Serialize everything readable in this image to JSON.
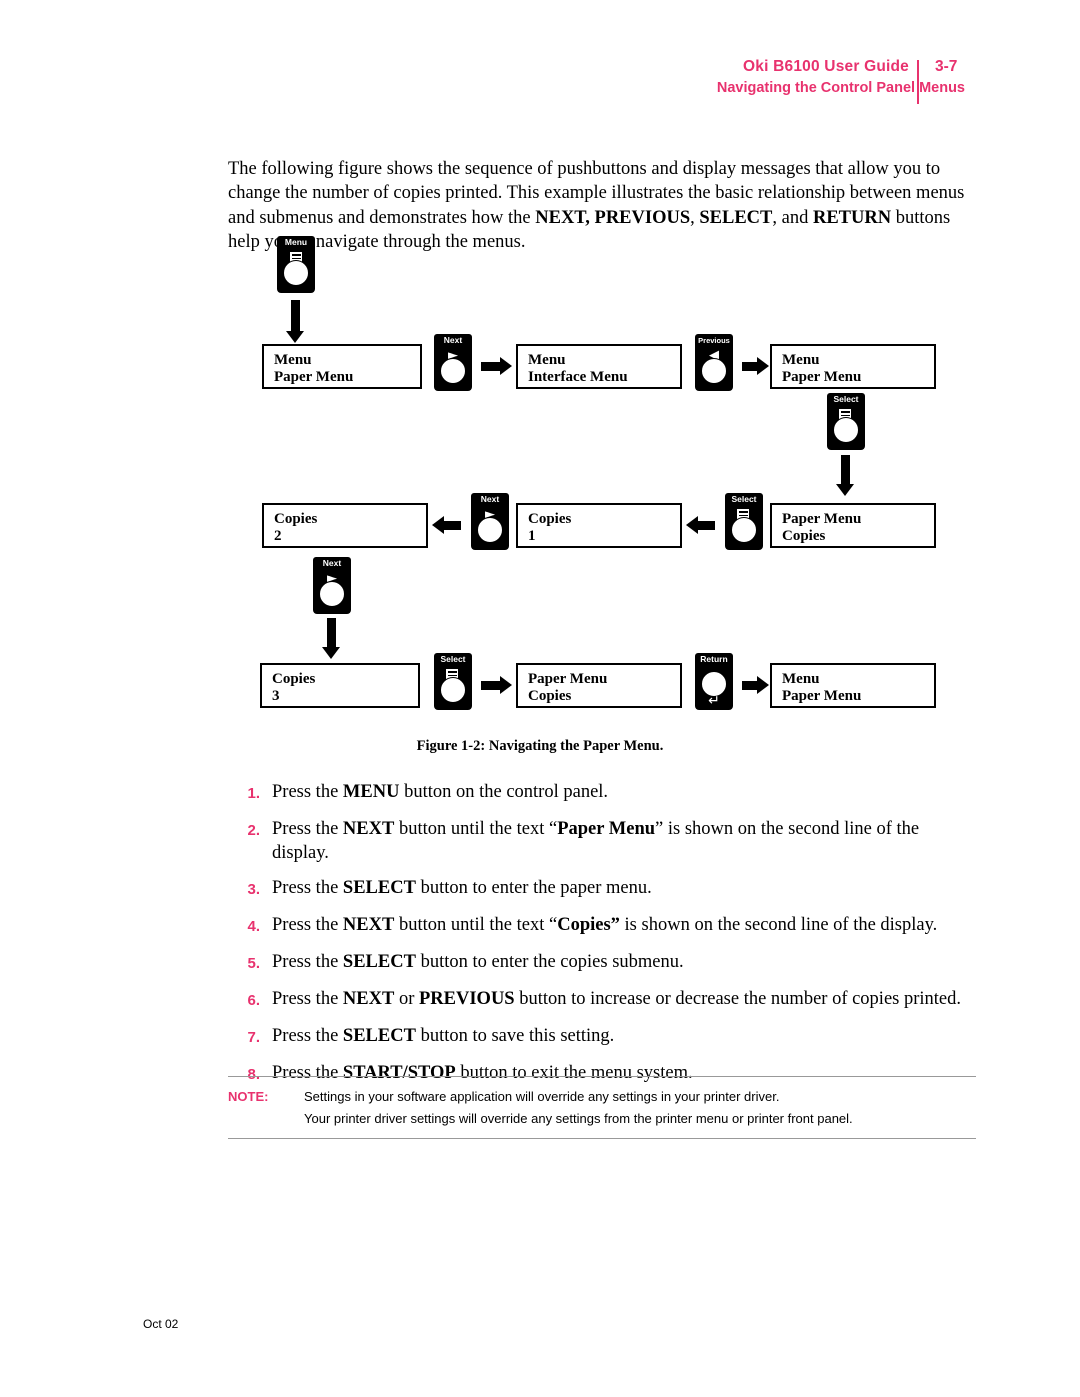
{
  "header": {
    "title": "Oki B6100 User Guide",
    "page": "3-7",
    "subtitle": "Navigating the Control Panel Menus",
    "accent": "#E8326E"
  },
  "intro": {
    "part1": "The following figure shows the sequence of pushbuttons and display messages that allow you to change the number of copies printed. This example illustrates the basic relationship between menus and submenus and demonstrates how the ",
    "bold1": "NEXT, PREVIOUS",
    "part2": ", ",
    "bold2": "SELECT",
    "part3": ", and ",
    "bold3": "RETURN",
    "part4": " buttons help you to navigate through the menus."
  },
  "figure": {
    "caption": "Figure 1-2:  Navigating the Paper Menu.",
    "buttons": {
      "menu": "Menu",
      "next": "Next",
      "previous": "Previous",
      "select": "Select",
      "return": "Return"
    },
    "displays": [
      {
        "line1": "Menu",
        "line2": "Paper Menu"
      },
      {
        "line1": "Menu",
        "line2": "Interface Menu"
      },
      {
        "line1": "Menu",
        "line2": "Paper Menu"
      },
      {
        "line1": "Copies",
        "line2": "2"
      },
      {
        "line1": "Copies",
        "line2": "1"
      },
      {
        "line1": "Paper Menu",
        "line2": "Copies"
      },
      {
        "line1": "Copies",
        "line2": "3"
      },
      {
        "line1": "Paper Menu",
        "line2": "Copies"
      },
      {
        "line1": "Menu",
        "line2": "Paper Menu"
      }
    ]
  },
  "steps": [
    {
      "num": "1.",
      "a": "Press the ",
      "b": "MENU",
      "c": " button on the control panel.",
      "d": "",
      "e": ""
    },
    {
      "num": "2.",
      "a": "Press the ",
      "b": "NEXT",
      "c": " button until the text “",
      "d": "Paper Menu",
      "e": "” is shown on the second line of the display."
    },
    {
      "num": "3.",
      "a": "Press the ",
      "b": "SELECT",
      "c": " button to enter the paper menu.",
      "d": "",
      "e": ""
    },
    {
      "num": "4.",
      "a": "Press the ",
      "b": "NEXT",
      "c": " button until the text “",
      "d": "Copies”",
      "e": " is shown on the second line of the display."
    },
    {
      "num": "5.",
      "a": "Press the ",
      "b": "SELECT",
      "c": " button to enter the copies submenu.",
      "d": "",
      "e": ""
    },
    {
      "num": "6.",
      "a": "Press the ",
      "b": "NEXT",
      "c": " or ",
      "d": "PREVIOUS",
      "e": " button to increase or decrease the number of copies printed."
    },
    {
      "num": "7.",
      "a": "Press the ",
      "b": "SELECT",
      "c": " button to save this setting.",
      "d": "",
      "e": ""
    },
    {
      "num": "8.",
      "a": "Press the ",
      "b": "START/STOP",
      "c": " button to exit the menu system.",
      "d": "",
      "e": ""
    }
  ],
  "note": {
    "label": "NOTE:",
    "line1": "Settings in your software application will override any settings in your printer driver.",
    "line2": "Your printer driver settings will override any settings from the printer menu or printer front panel."
  },
  "footer": {
    "date": "Oct 02"
  }
}
